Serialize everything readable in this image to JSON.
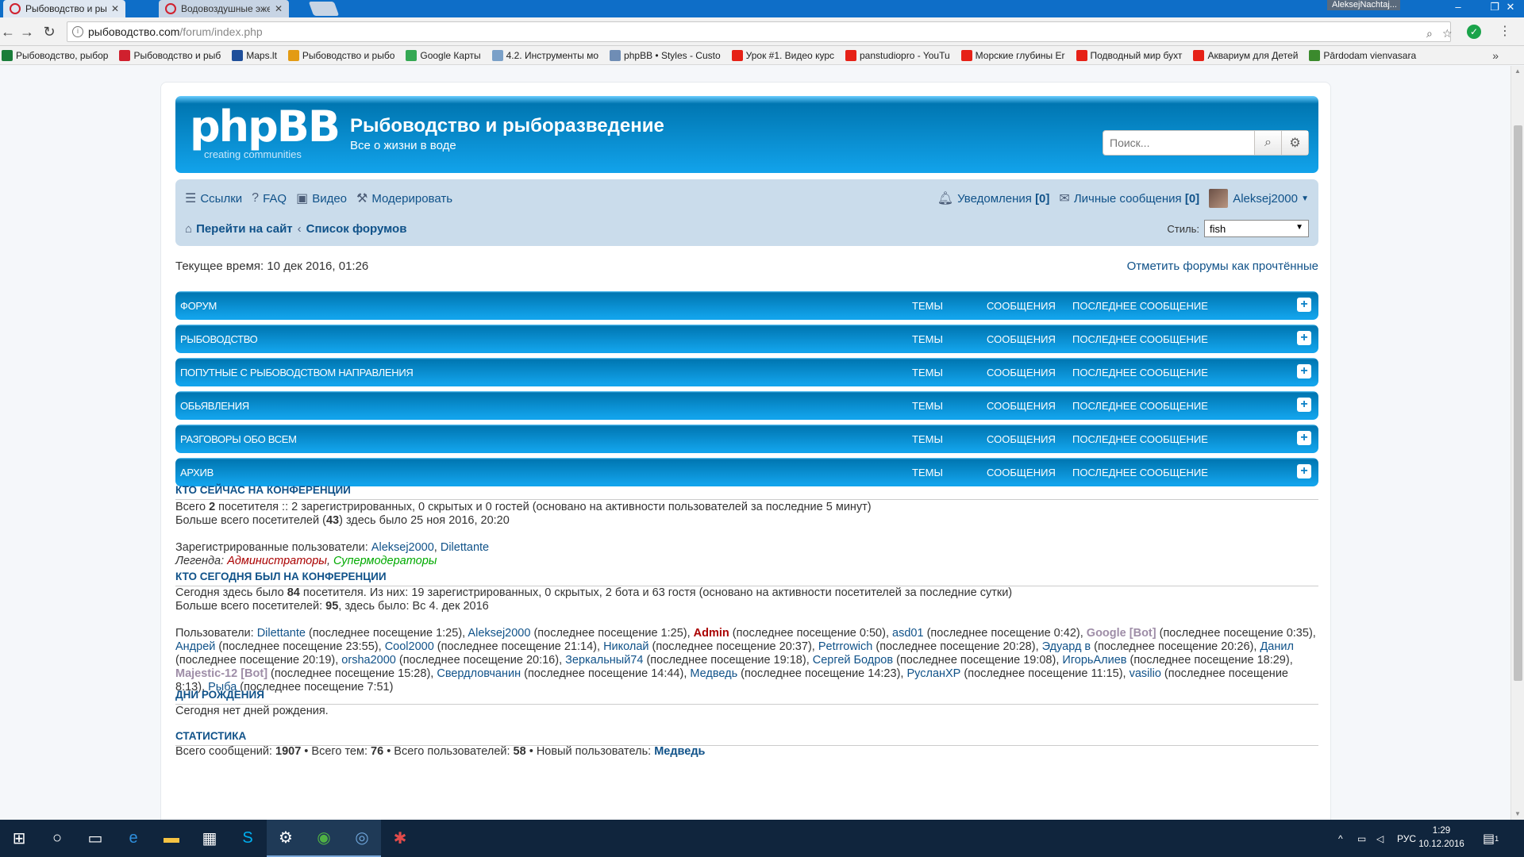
{
  "browser": {
    "tabs": [
      {
        "title": "Рыбоводство и рыбора",
        "active": true
      },
      {
        "title": "Водовоздушные эжекто",
        "active": false
      }
    ],
    "profile_name": "AleksejNachtaj...",
    "url_host": "рыбоводство.com",
    "url_path": "/forum/index.php",
    "bookmarks": [
      {
        "label": "Рыбоводство, рыбор",
        "color": "#1a7d3a"
      },
      {
        "label": "Рыбоводство и рыб",
        "color": "#d0202e"
      },
      {
        "label": "Maps.lt",
        "color": "#1f4f9a"
      },
      {
        "label": "Рыбоводство и рыбо",
        "color": "#e39b14"
      },
      {
        "label": "Google Карты",
        "color": "#34a853"
      },
      {
        "label": "4.2. Инструменты мо",
        "color": "#7aa0c8"
      },
      {
        "label": "phpBB • Styles - Custo",
        "color": "#6f8db5"
      },
      {
        "label": "Урок #1. Видео курс",
        "color": "#e62117"
      },
      {
        "label": "panstudiopro - YouTu",
        "color": "#e62117"
      },
      {
        "label": "Морские глубины Er",
        "color": "#e62117"
      },
      {
        "label": "Подводный мир бухт",
        "color": "#e62117"
      },
      {
        "label": "Аквариум для Детей",
        "color": "#e62117"
      },
      {
        "label": "Pārdodam vienvasara",
        "color": "#3b8a2d"
      }
    ],
    "bookmarks_more": "»"
  },
  "header": {
    "logo_text": "phpBB",
    "logo_tagline": "creating communities",
    "site_title": "Рыбоводство и рыборазведение",
    "site_description": "Все о жизни в воде",
    "search_placeholder": "Поиск..."
  },
  "nav": {
    "links": [
      {
        "label": "Ссылки",
        "icon": "menu-icon"
      },
      {
        "label": "FAQ",
        "icon": "help-icon"
      },
      {
        "label": "Видео",
        "icon": "video-icon"
      },
      {
        "label": "Модерировать",
        "icon": "moderate-icon"
      }
    ],
    "notifications_label": "Уведомления",
    "notifications_count": "[0]",
    "messages_label": "Личные сообщения",
    "messages_count": "[0]",
    "username": "Aleksej2000",
    "breadcrumb_home": "Перейти на сайт",
    "breadcrumb_index": "Список форумов",
    "style_label": "Стиль:",
    "style_value": "fish"
  },
  "current_time": "Текущее время: 10 дек 2016, 01:26",
  "mark_read": "Отметить форумы как прочтённые",
  "columns": {
    "topics": "Темы",
    "posts": "Сообщения",
    "last_post": "Последнее сообщение"
  },
  "categories": [
    "Форум",
    "Рыбоводство",
    "Попутные с рыбоводством направления",
    "Обьявления",
    "Разговоры обо всем",
    "Архив"
  ],
  "online": {
    "heading": "Кто сейчас на конференции",
    "line1_pre": "Всего ",
    "line1_num": "2",
    "line1_post": " посетителя :: 2 зарегистрированных, 0 скрытых и 0 гостей (основано на активности пользователей за последние 5 минут)",
    "line2_pre": "Больше всего посетителей (",
    "line2_num": "43",
    "line2_post": ") здесь было 25 ноя 2016, 20:20",
    "registered_label": "Зарегистрированные пользователи: ",
    "registered_users": [
      "Aleksej2000",
      "Dilettante"
    ],
    "legend_label": "Легенда: ",
    "legend_admins": "Администраторы",
    "legend_smods": "Супермодераторы"
  },
  "today": {
    "heading": "Кто сегодня был на конференции",
    "line1_pre": "Сегодня здесь было ",
    "line1_num": "84",
    "line1_post": " посетителя. Из них: 19 зарегистрированных, 0 скрытых, 2 бота и 63 гостя (основано на активности посетителей за последние сутки)",
    "line2_pre": "Больше всего посетителей: ",
    "line2_num": "95",
    "line2_post": ", здесь было: Вс 4. дек 2016",
    "users_label": "Пользователи: ",
    "users": [
      {
        "name": "Dilettante",
        "seen": "последнее посещение 1:25",
        "kind": "user"
      },
      {
        "name": "Aleksej2000",
        "seen": "последнее посещение 1:25",
        "kind": "user"
      },
      {
        "name": "Admin",
        "seen": "последнее посещение 0:50",
        "kind": "admin"
      },
      {
        "name": "asd01",
        "seen": "последнее посещение 0:42",
        "kind": "user"
      },
      {
        "name": "Google [Bot]",
        "seen": "последнее посещение 0:35",
        "kind": "bot"
      },
      {
        "name": "Андрей",
        "seen": "последнее посещение 23:55",
        "kind": "user"
      },
      {
        "name": "Cool2000",
        "seen": "последнее посещение 21:14",
        "kind": "user"
      },
      {
        "name": "Николай",
        "seen": "последнее посещение 20:37",
        "kind": "user"
      },
      {
        "name": "Petrrowich",
        "seen": "последнее посещение 20:28",
        "kind": "user"
      },
      {
        "name": "Эдуард в",
        "seen": "последнее посещение 20:26",
        "kind": "user"
      },
      {
        "name": "Данил",
        "seen": "последнее посещение 20:19",
        "kind": "user"
      },
      {
        "name": "orsha2000",
        "seen": "последнее посещение 20:16",
        "kind": "user"
      },
      {
        "name": "Зеркальный74",
        "seen": "последнее посещение 19:18",
        "kind": "user"
      },
      {
        "name": "Сергей Бодров",
        "seen": "последнее посещение 19:08",
        "kind": "user"
      },
      {
        "name": "ИгорьАлиев",
        "seen": "последнее посещение 18:29",
        "kind": "user"
      },
      {
        "name": "Majestic-12 [Bot]",
        "seen": "последнее посещение 15:28",
        "kind": "bot"
      },
      {
        "name": "Свердловчанин",
        "seen": "последнее посещение 14:44",
        "kind": "user"
      },
      {
        "name": "Медведь",
        "seen": "последнее посещение 14:23",
        "kind": "user"
      },
      {
        "name": "РусланХР",
        "seen": "последнее посещение 11:15",
        "kind": "user"
      },
      {
        "name": "vasilio",
        "seen": "последнее посещение 8:13",
        "kind": "user"
      },
      {
        "name": "Рыба",
        "seen": "последнее посещение 7:51",
        "kind": "user"
      }
    ]
  },
  "birthdays": {
    "heading": "Дни рождения",
    "text": "Сегодня нет дней рождения."
  },
  "stats": {
    "heading": "Статистика",
    "posts_label": "Всего сообщений: ",
    "posts": "1907",
    "topics_label": " • Всего тем: ",
    "topics": "76",
    "users_label": " • Всего пользователей: ",
    "users": "58",
    "newest_label": " • Новый пользователь: ",
    "newest": "Медведь"
  },
  "taskbar": {
    "language": "РУС",
    "time": "1:29",
    "date": "10.12.2016",
    "notifications": "1"
  }
}
